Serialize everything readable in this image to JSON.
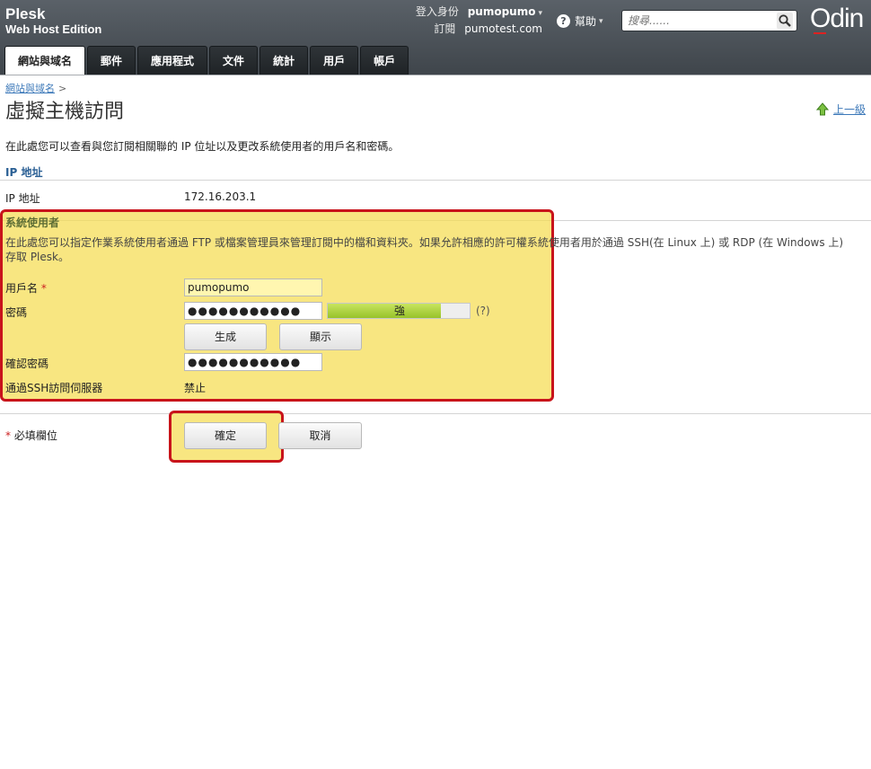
{
  "header": {
    "brand_line1": "Plesk",
    "brand_line2": "Web Host Edition",
    "login_label": "登入身份",
    "login_user": "pumopumo",
    "subscription_label": "訂閱",
    "subscription_value": "pumotest.com",
    "help_label": "幫助",
    "search_placeholder": "搜尋......",
    "logo_text": "Odin"
  },
  "tabs": [
    {
      "label": "網站與域名"
    },
    {
      "label": "郵件"
    },
    {
      "label": "應用程式"
    },
    {
      "label": "文件"
    },
    {
      "label": "統計"
    },
    {
      "label": "用戶"
    },
    {
      "label": "帳戶"
    }
  ],
  "breadcrumb": {
    "link": "網站與域名",
    "sep": ">"
  },
  "page": {
    "title": "虛擬主機訪問",
    "up_label": "上一級",
    "intro": "在此處您可以查看與您訂閱相關聯的 IP 位址以及更改系統使用者的用戶名和密碼。"
  },
  "ip_section": {
    "title": "IP 地址",
    "label": "IP 地址",
    "value": "172.16.203.1"
  },
  "sys_section": {
    "title": "系統使用者",
    "description": "在此處您可以指定作業系統使用者通過 FTP 或檔案管理員來管理訂閱中的檔和資料夾。如果允許相應的許可權系統使用者用於通過 SSH(在 Linux 上) 或 RDP (在 Windows 上) 存取 Plesk。",
    "username_label": "用戶名",
    "username_required": "*",
    "username_value": "pumopumo",
    "password_label": "密碼",
    "password_value": "●●●●●●●●●●●",
    "strength_label": "強",
    "strength_level": 0.8,
    "strength_help": "(?)",
    "generate_label": "生成",
    "show_label": "顯示",
    "confirm_label": "確認密碼",
    "confirm_value": "●●●●●●●●●●●",
    "ssh_label": "通過SSH訪問伺服器",
    "ssh_value": "禁止"
  },
  "footer": {
    "required_star": "*",
    "required_text": "必填欄位",
    "ok_label": "確定",
    "cancel_label": "取消"
  },
  "colors": {
    "highlight": "#f5dc50",
    "highlight_border": "#c8141b",
    "link": "#3d79b9",
    "section_title": "#2a5f94"
  }
}
